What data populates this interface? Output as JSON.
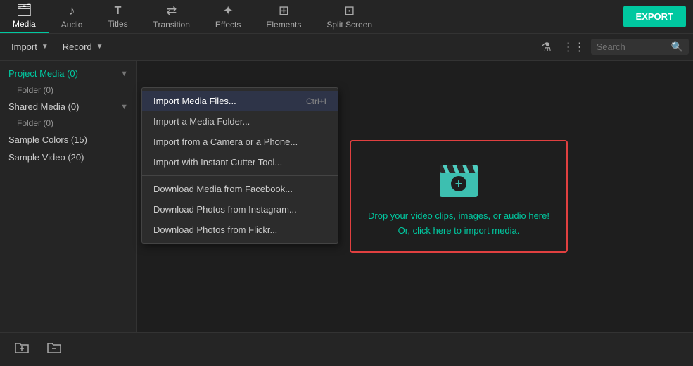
{
  "topNav": {
    "items": [
      {
        "id": "media",
        "label": "Media",
        "icon": "🗂",
        "active": true
      },
      {
        "id": "audio",
        "label": "Audio",
        "icon": "♪"
      },
      {
        "id": "titles",
        "label": "Titles",
        "icon": "T"
      },
      {
        "id": "transition",
        "label": "Transition",
        "icon": "⇄"
      },
      {
        "id": "effects",
        "label": "Effects",
        "icon": "✦"
      },
      {
        "id": "elements",
        "label": "Elements",
        "icon": "⊞"
      },
      {
        "id": "splitscreen",
        "label": "Split Screen",
        "icon": "⊡"
      }
    ],
    "exportLabel": "EXPORT"
  },
  "secondRow": {
    "importLabel": "Import",
    "recordLabel": "Record",
    "searchPlaceholder": "Search"
  },
  "sidebar": {
    "items": [
      {
        "label": "Project Media (0)",
        "active": true,
        "hasChevron": true
      },
      {
        "label": "Folder (0)",
        "isSub": true
      },
      {
        "label": "Shared Media (0)",
        "hasChevron": true
      },
      {
        "label": "Folder (0)",
        "isSub": true
      },
      {
        "label": "Sample Colors (15)"
      },
      {
        "label": "Sample Video (20)"
      }
    ]
  },
  "dropdownMenu": {
    "items": [
      {
        "label": "Import Media Files...",
        "shortcut": "Ctrl+I",
        "highlighted": true
      },
      {
        "label": "Import a Media Folder..."
      },
      {
        "label": "Import from a Camera or a Phone..."
      },
      {
        "label": "Import with Instant Cutter Tool..."
      },
      {
        "divider": true
      },
      {
        "label": "Download Media from Facebook..."
      },
      {
        "label": "Download Photos from Instagram..."
      },
      {
        "label": "Download Photos from Flickr..."
      }
    ]
  },
  "dropZone": {
    "line1": "Drop your video clips, images, or audio here!",
    "line2": "Or, click here to import media."
  },
  "bottomToolbar": {
    "addFolderLabel": "Add Folder",
    "deleteFolderLabel": "Delete Folder"
  }
}
